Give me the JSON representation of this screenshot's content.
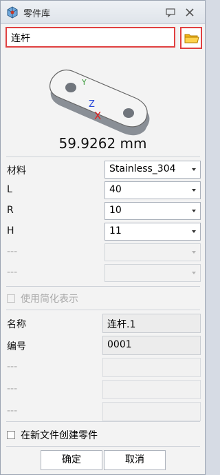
{
  "window": {
    "title": "零件库",
    "icons": {
      "app": "part-library-icon",
      "minimize": "comment-icon",
      "close": "close-icon"
    }
  },
  "part": {
    "name": "连杆",
    "browse_icon": "folder-icon",
    "preview_icon": "link-part-3d-icon",
    "axis_labels": {
      "y": "Y",
      "z": "Z",
      "x": "X"
    },
    "measurement": "59.9262 mm"
  },
  "params": [
    {
      "label": "材料",
      "value": "Stainless_304",
      "enabled": true
    },
    {
      "label": "L",
      "value": "40",
      "enabled": true
    },
    {
      "label": "R",
      "value": "10",
      "enabled": true
    },
    {
      "label": "H",
      "value": "11",
      "enabled": true
    },
    {
      "label": "---",
      "value": "",
      "enabled": false
    },
    {
      "label": "---",
      "value": "",
      "enabled": false
    }
  ],
  "simplified": {
    "label": "使用简化表示",
    "checked": false,
    "enabled": false
  },
  "attributes": [
    {
      "label": "名称",
      "value": "连杆.1",
      "enabled": true
    },
    {
      "label": "编号",
      "value": "0001",
      "enabled": true
    },
    {
      "label": "---",
      "value": "",
      "enabled": false
    },
    {
      "label": "---",
      "value": "",
      "enabled": false
    },
    {
      "label": "---",
      "value": "",
      "enabled": false
    }
  ],
  "new_file": {
    "label": "在新文件创建零件",
    "checked": false
  },
  "buttons": {
    "ok": "确定",
    "cancel": "取消"
  },
  "colors": {
    "highlight": "#e04040",
    "folder": "#f2b417"
  }
}
